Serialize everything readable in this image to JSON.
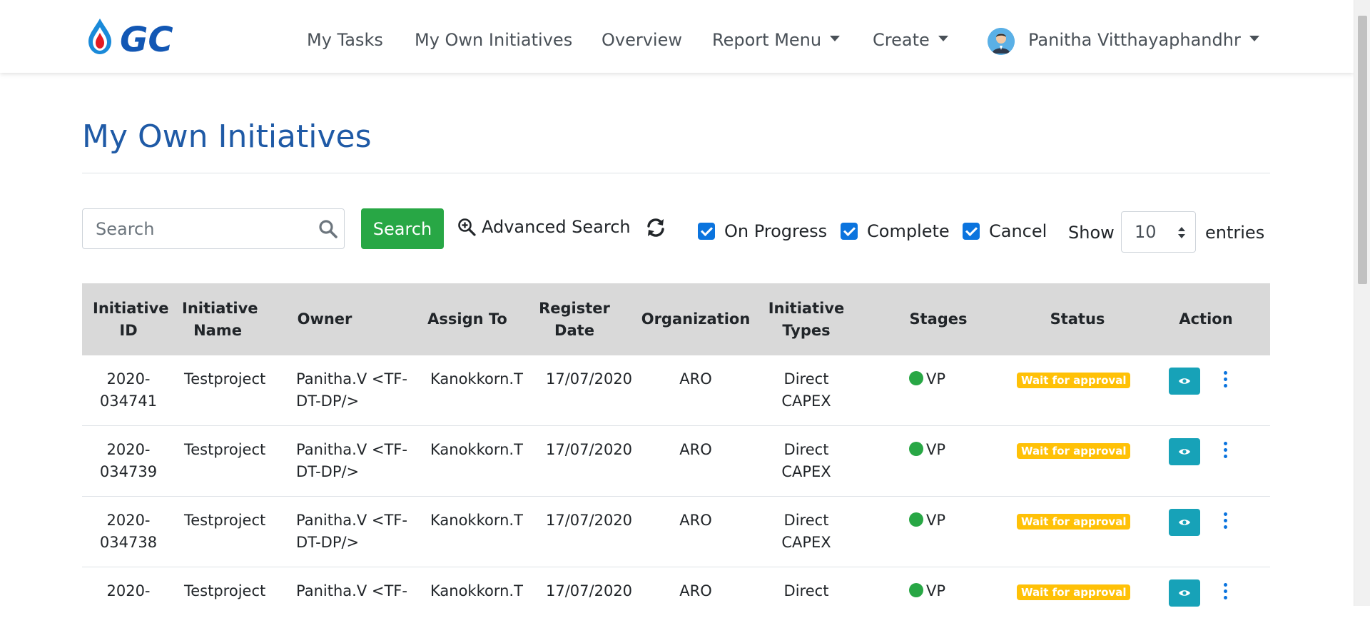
{
  "navbar": {
    "logo_text": "GC",
    "items": [
      {
        "label": "My Tasks"
      },
      {
        "label": "My Own Initiatives"
      },
      {
        "label": "Overview"
      },
      {
        "label": "Report Menu"
      },
      {
        "label": "Create"
      }
    ],
    "user_name": "Panitha Vitthayaphandhr"
  },
  "page": {
    "title": "My Own Initiatives"
  },
  "toolbar": {
    "search_placeholder": "Search",
    "search_button": "Search",
    "advanced_search": "Advanced Search",
    "filters": [
      {
        "label": "On Progress",
        "checked": true
      },
      {
        "label": "Complete",
        "checked": true
      },
      {
        "label": "Cancel",
        "checked": true
      }
    ],
    "show_label": "Show",
    "entries_value": "10",
    "entries_label": "entries"
  },
  "table": {
    "headers": [
      "Initiative ID",
      "Initiative Name",
      "Owner",
      "Assign To",
      "Register Date",
      "Organization",
      "Initiative Types",
      "Stages",
      "Status",
      "Action"
    ],
    "rows": [
      {
        "id": "2020-034741",
        "name": "Testproject",
        "owner": "Panitha.V <TF-DT-DP/>",
        "assign_to": "Kanokkorn.T",
        "register_date": "17/07/2020",
        "organization": "ARO",
        "types": "Direct CAPEX",
        "stage": "VP",
        "status": "Wait for approval"
      },
      {
        "id": "2020-034739",
        "name": "Testproject",
        "owner": "Panitha.V <TF-DT-DP/>",
        "assign_to": "Kanokkorn.T",
        "register_date": "17/07/2020",
        "organization": "ARO",
        "types": "Direct CAPEX",
        "stage": "VP",
        "status": "Wait for approval"
      },
      {
        "id": "2020-034738",
        "name": "Testproject",
        "owner": "Panitha.V <TF-DT-DP/>",
        "assign_to": "Kanokkorn.T",
        "register_date": "17/07/2020",
        "organization": "ARO",
        "types": "Direct CAPEX",
        "stage": "VP",
        "status": "Wait for approval"
      },
      {
        "id": "2020-",
        "name": "Testproject",
        "owner": "Panitha.V <TF-",
        "assign_to": "Kanokkorn.T",
        "register_date": "17/07/2020",
        "organization": "ARO",
        "types": "Direct",
        "stage": "VP",
        "status": "Wait for approval"
      }
    ]
  },
  "colors": {
    "brand_blue": "#1f5aa6",
    "search_green": "#28a745",
    "checkbox_blue": "#0b74de",
    "status_badge": "#ffc107",
    "view_button": "#17a2b8",
    "stage_dot": "#28a745"
  }
}
